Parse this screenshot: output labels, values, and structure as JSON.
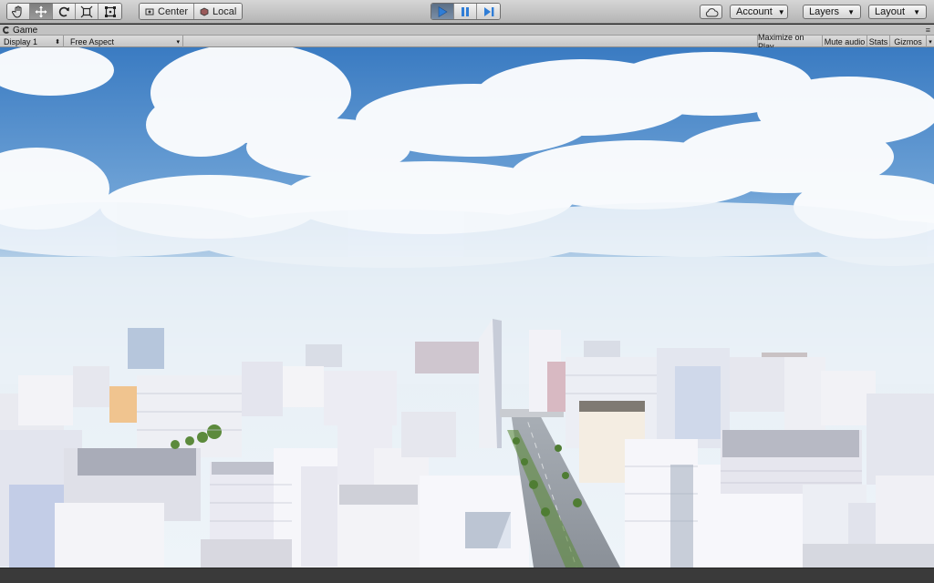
{
  "toolbar": {
    "tools": [
      {
        "name": "hand-tool-button",
        "icon": "hand-icon",
        "active": false
      },
      {
        "name": "move-tool-button",
        "icon": "move-arrows-icon",
        "active": true
      },
      {
        "name": "rotate-tool-button",
        "icon": "rotate-icon",
        "active": false
      },
      {
        "name": "scale-tool-button",
        "icon": "scale-icon",
        "active": false
      },
      {
        "name": "rect-tool-button",
        "icon": "rect-transform-icon",
        "active": false
      }
    ],
    "pivot_label": "Center",
    "space_label": "Local",
    "play_controls": [
      {
        "name": "play-button",
        "icon": "play-icon",
        "active": true
      },
      {
        "name": "pause-button",
        "icon": "pause-icon",
        "active": false
      },
      {
        "name": "step-button",
        "icon": "step-icon",
        "active": false
      }
    ],
    "cloud_icon": "cloud-icon",
    "account_label": "Account",
    "layers_label": "Layers",
    "layout_label": "Layout"
  },
  "game_tab": {
    "title": "Game",
    "display_label": "Display 1",
    "aspect_label": "Free Aspect",
    "maximize_label": "Maximize on Play",
    "mute_label": "Mute audio",
    "stats_label": "Stats",
    "gizmos_label": "Gizmos"
  },
  "colors": {
    "accent_play": "#2f7dd6",
    "sky_top": "#3d7ec4",
    "sky_horizon": "#eef4f9"
  }
}
